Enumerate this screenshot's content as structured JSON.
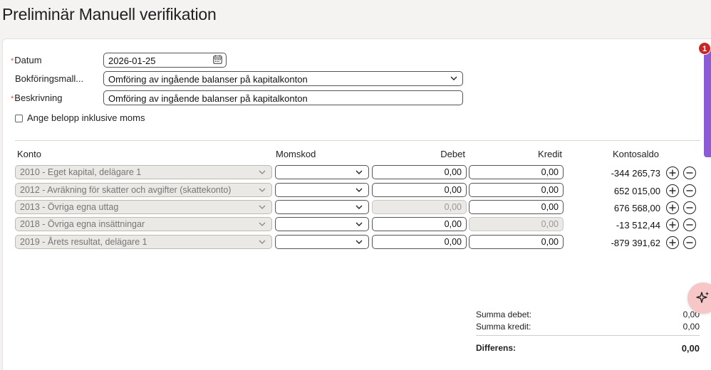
{
  "page": {
    "title": "Preliminär Manuell verifikation"
  },
  "form": {
    "date_label": "Datum",
    "date_value": "2026-01-25",
    "template_label": "Bokföringsmall...",
    "template_value": "Omföring av ingående balanser på kapitalkonton",
    "description_label": "Beskrivning",
    "description_value": "Omföring av ingående balanser på kapitalkonton",
    "vat_checkbox_label": "Ange belopp inklusive moms",
    "vat_checkbox_checked": false
  },
  "table": {
    "headers": {
      "account": "Konto",
      "vat": "Momskod",
      "debit": "Debet",
      "credit": "Kredit",
      "balance": "Kontosaldo"
    },
    "rows": [
      {
        "account": "2010 - Eget kapital, delägare 1",
        "vat": "",
        "debit": "0,00",
        "credit": "0,00",
        "balance": "-344 265,73",
        "debit_enabled": true,
        "credit_enabled": true
      },
      {
        "account": "2012 - Avräkning för skatter och avgifter (skattekonto)",
        "vat": "",
        "debit": "0,00",
        "credit": "0,00",
        "balance": "652 015,00",
        "debit_enabled": true,
        "credit_enabled": true
      },
      {
        "account": "2013 - Övriga egna uttag",
        "vat": "",
        "debit": "0,00",
        "credit": "0,00",
        "balance": "676 568,00",
        "debit_enabled": false,
        "credit_enabled": true
      },
      {
        "account": "2018 - Övriga egna insättningar",
        "vat": "",
        "debit": "0,00",
        "credit": "0,00",
        "balance": "-13 512,44",
        "debit_enabled": true,
        "credit_enabled": false
      },
      {
        "account": "2019 - Årets resultat, delägare 1",
        "vat": "",
        "debit": "0,00",
        "credit": "0,00",
        "balance": "-879 391,62",
        "debit_enabled": true,
        "credit_enabled": true
      }
    ]
  },
  "summary": {
    "debit_label": "Summa debet:",
    "debit_value": "0,00",
    "credit_label": "Summa kredit:",
    "credit_value": "0,00",
    "difference_label": "Differens:",
    "difference_value": "0,00"
  },
  "notifications": {
    "badge_count": "1"
  },
  "icons": {
    "calendar": "calendar-icon",
    "dropdown": "chevron-down-icon",
    "add": "plus-circle-icon",
    "remove": "minus-circle-icon",
    "assistant": "sparkle-icon"
  },
  "colors": {
    "required": "#d9534f",
    "badge": "#c62828",
    "side_tab": "#8b5cd6",
    "fab": "#f7c6c6"
  }
}
